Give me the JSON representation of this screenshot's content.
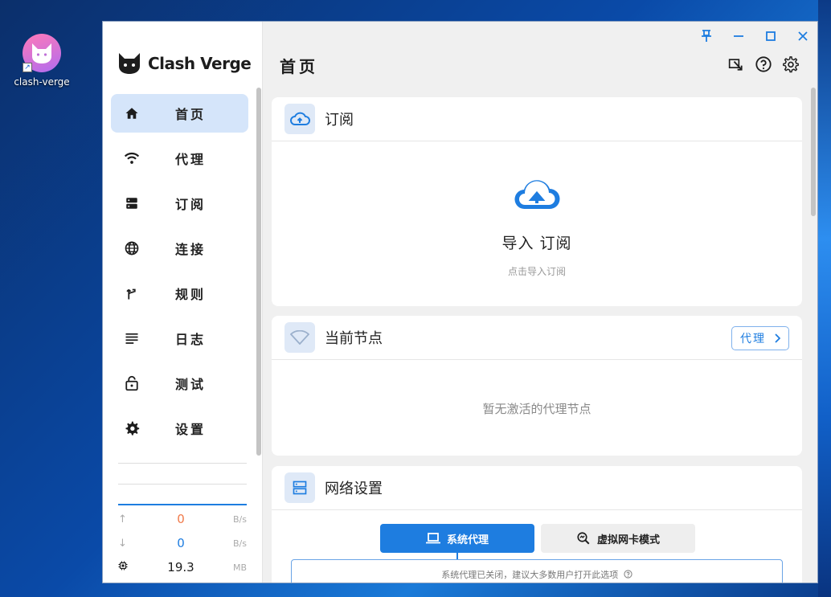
{
  "desktop": {
    "icon_label": "clash-verge"
  },
  "app": {
    "name": "Clash Verge"
  },
  "sidebar": {
    "items": [
      {
        "label": "首页",
        "icon": "home-icon"
      },
      {
        "label": "代理",
        "icon": "wifi-icon"
      },
      {
        "label": "订阅",
        "icon": "server-icon"
      },
      {
        "label": "连接",
        "icon": "globe-icon"
      },
      {
        "label": "规则",
        "icon": "fork-icon"
      },
      {
        "label": "日志",
        "icon": "lines-icon"
      },
      {
        "label": "测试",
        "icon": "lock-icon"
      },
      {
        "label": "设置",
        "icon": "gear-icon"
      }
    ],
    "active": "首页"
  },
  "traffic": {
    "upload": {
      "value": "0",
      "unit": "B/s"
    },
    "download": {
      "value": "0",
      "unit": "B/s"
    },
    "memory": {
      "value": "19.3",
      "unit": "MB"
    }
  },
  "header": {
    "title": "首页"
  },
  "cards": {
    "subscription": {
      "title": "订阅",
      "import_title": "导入 订阅",
      "import_sub": "点击导入订阅"
    },
    "current_node": {
      "title": "当前节点",
      "button": "代理",
      "empty": "暂无激活的代理节点"
    },
    "network": {
      "title": "网络设置",
      "tab_system": "系统代理",
      "tab_tun": "虚拟网卡模式",
      "status": "系统代理已关闭，建议大多数用户打开此选项"
    }
  },
  "colors": {
    "accent": "#1e7de0",
    "upload": "#f07a4a",
    "download": "#1e7de0"
  }
}
